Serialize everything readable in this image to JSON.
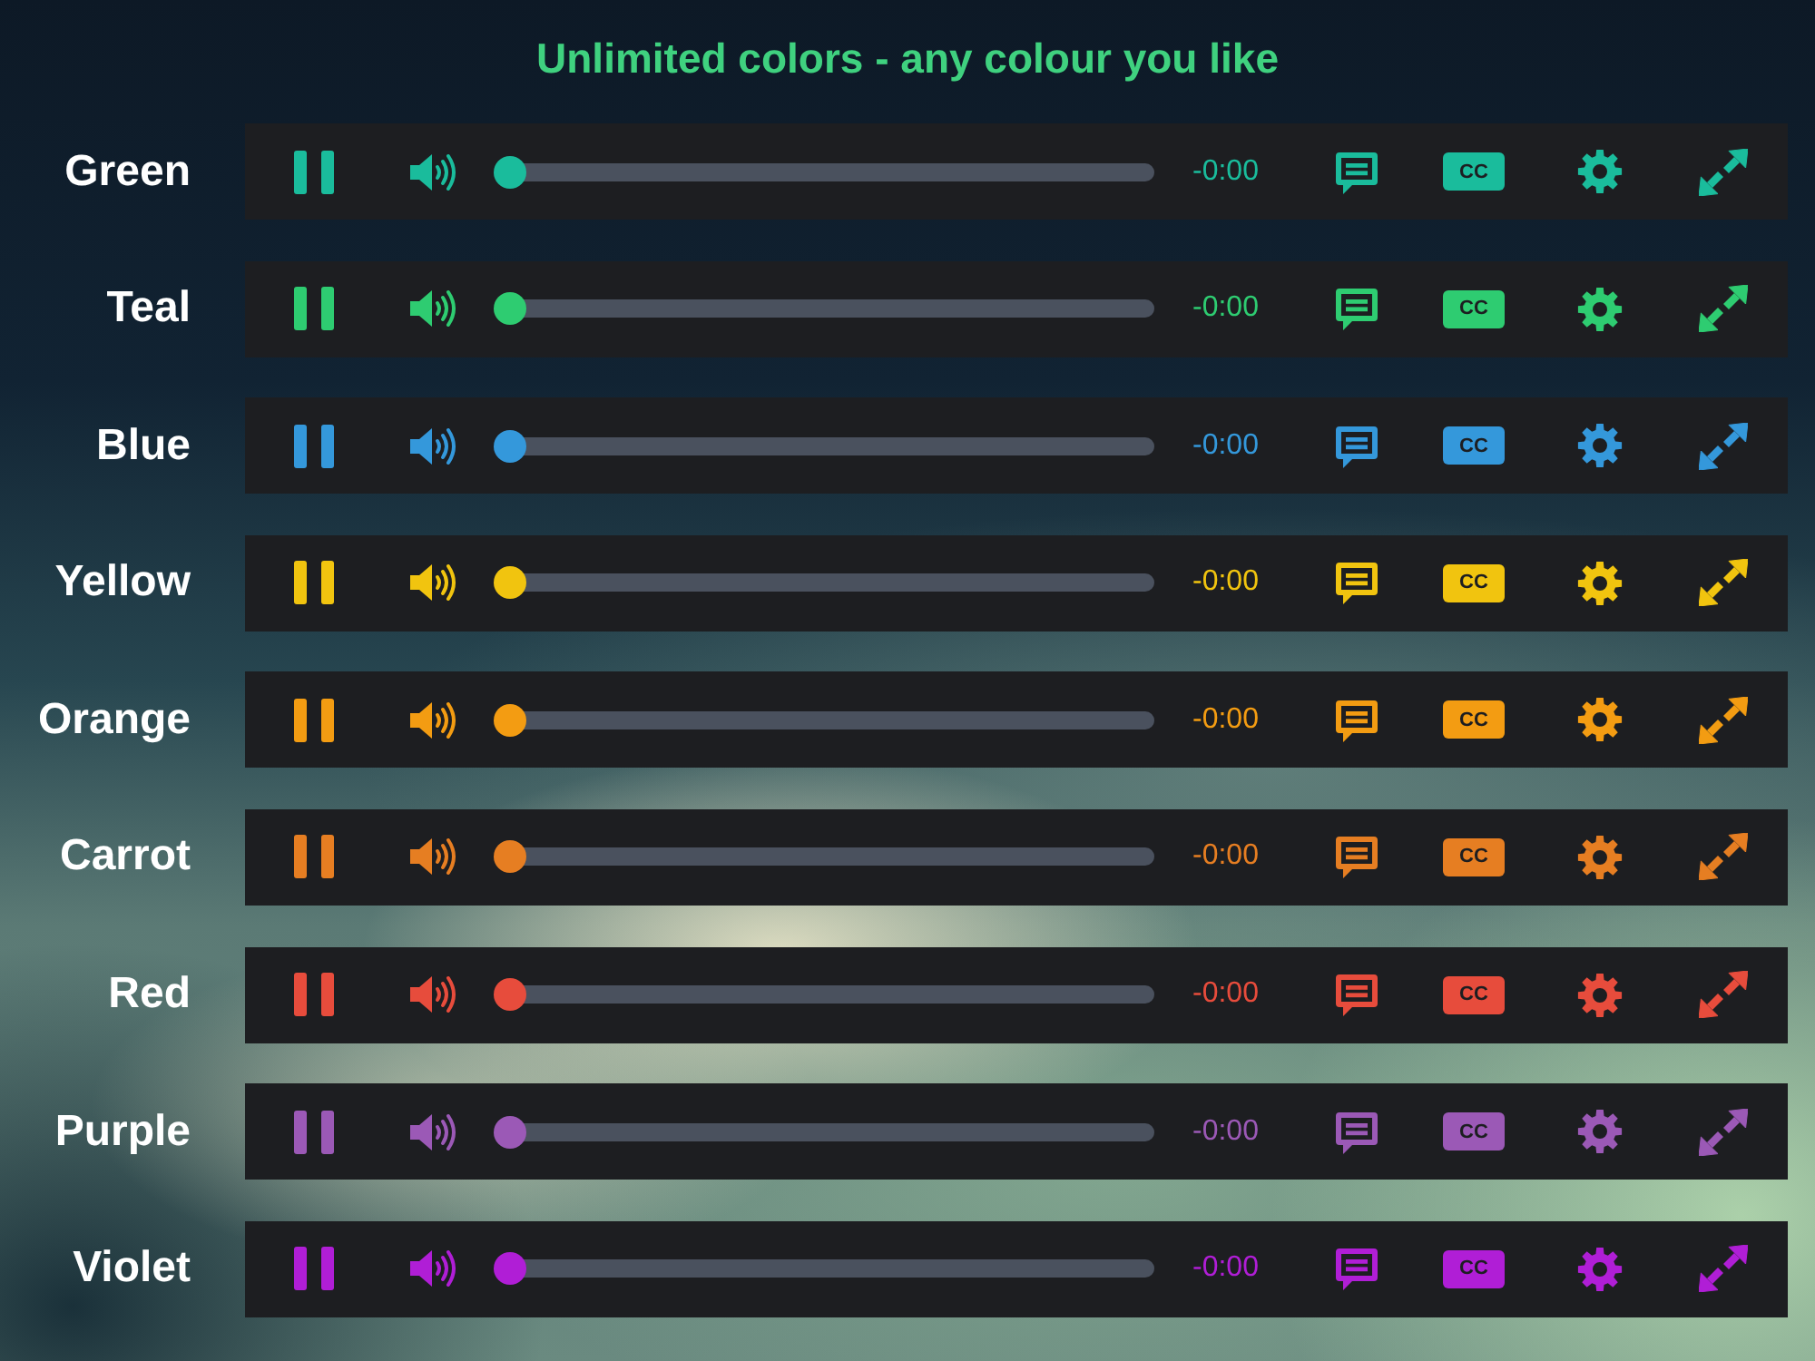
{
  "title": "Unlimited colors - any colour you like",
  "players": [
    {
      "label": "Green",
      "color": "#1abc9c",
      "playing": true,
      "muted": false,
      "level": 0,
      "time": "-0:00",
      "captions": "CC"
    },
    {
      "label": "Teal",
      "color": "#2ecc71",
      "playing": true,
      "muted": false,
      "level": 0,
      "time": "-0:00",
      "captions": "CC"
    },
    {
      "label": "Blue",
      "color": "#3498db",
      "playing": true,
      "muted": false,
      "level": 0,
      "time": "-0:00",
      "captions": "CC"
    },
    {
      "label": "Yellow",
      "color": "#f1c40f",
      "playing": true,
      "muted": false,
      "level": 0,
      "time": "-0:00",
      "captions": "CC"
    },
    {
      "label": "Orange",
      "color": "#f39c12",
      "playing": true,
      "muted": false,
      "level": 0,
      "time": "-0:00",
      "captions": "CC"
    },
    {
      "label": "Carrot",
      "color": "#e67e22",
      "playing": true,
      "muted": false,
      "level": 0,
      "time": "-0:00",
      "captions": "CC"
    },
    {
      "label": "Red",
      "color": "#e74c3c",
      "playing": true,
      "muted": false,
      "level": 0,
      "time": "-0:00",
      "captions": "CC"
    },
    {
      "label": "Purple",
      "color": "#9b59b6",
      "playing": true,
      "muted": false,
      "level": 0,
      "time": "-0:00",
      "captions": "CC"
    },
    {
      "label": "Violet",
      "color": "#b01ed6",
      "playing": true,
      "muted": false,
      "level": 0,
      "time": "-0:00",
      "captions": "CC"
    }
  ]
}
